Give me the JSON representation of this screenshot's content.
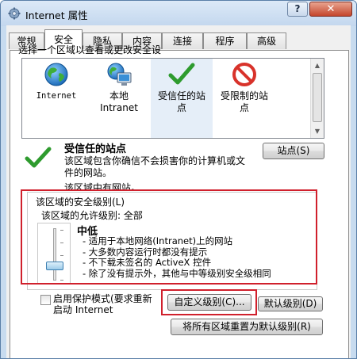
{
  "window": {
    "title": "Internet 属性",
    "help_glyph": "?",
    "close_glyph": "✕"
  },
  "tabs": [
    "常规",
    "安全",
    "隐私",
    "内容",
    "连接",
    "程序",
    "高级"
  ],
  "active_tab": "安全",
  "zone_prompt": "选择一个区域以查看或更改安全设",
  "zones": [
    {
      "label": "Internet",
      "icon": "globe-icon"
    },
    {
      "label": "本地\nIntranet",
      "icon": "intranet-icon"
    },
    {
      "label": "受信任的站\n点",
      "icon": "checkmark-icon",
      "selected": true
    },
    {
      "label": "受限制的站\n点",
      "icon": "restricted-icon"
    }
  ],
  "site": {
    "title": "受信任的站点",
    "desc": "该区域包含你确信不会损害你的计算机或文\n件的网站。",
    "none_text": "该区域中有网站。",
    "sites_button": "站点(S)"
  },
  "security_level": {
    "group_title": "该区域的安全级别(L)",
    "allowed": "该区域的允许级别: 全部",
    "level_name": "中低",
    "slider_level_fraction": 0.25,
    "bullets": [
      "- 适用于本地网络(Intranet)上的网站",
      "- 大多数内容运行时都没有提示",
      "- 不下载未签名的 ActiveX 控件",
      "- 除了没有提示外，其他与中等级别安全级相同"
    ]
  },
  "protected_mode": {
    "label": "启用保护模式(要求重新\n启动 Internet",
    "checked": false
  },
  "buttons": {
    "custom_level": "自定义级别(C)...",
    "default_level": "默认级别(D)",
    "reset_all": "将所有区域重置为默认级别(R)"
  },
  "colors": {
    "highlight_red": "#d0202c",
    "selected_zone_bg": "#e5eef8",
    "check_green": "#2e9b2e",
    "restricted_red": "#d8322a"
  }
}
